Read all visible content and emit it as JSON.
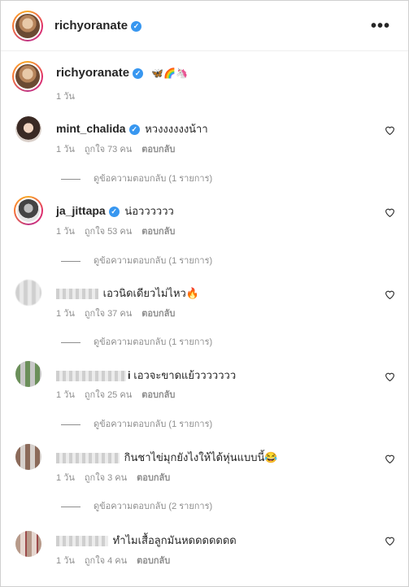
{
  "header": {
    "username": "richyoranate",
    "verified_icon": "check-badge-icon",
    "more_label": "•••"
  },
  "caption": {
    "username": "richyoranate",
    "text": "🦋🌈🦄",
    "time": "1 วัน"
  },
  "comments": [
    {
      "username": "mint_chalida",
      "verified": true,
      "text": "หวงงงงงงน้าา",
      "time": "1 วัน",
      "likes": "ถูกใจ 73 คน",
      "reply": "ตอบกลับ",
      "view_replies": "ดูข้อความตอบกลับ (1 รายการ)"
    },
    {
      "username": "ja_jittapa",
      "verified": true,
      "text": "น่อวววววว",
      "time": "1 วัน",
      "likes": "ถูกใจ 53 คน",
      "reply": "ตอบกลับ",
      "view_replies": "ดูข้อความตอบกลับ (1 รายการ)"
    },
    {
      "username_suffix": "",
      "text": "เอวนิดเดียวไม่ไหว🔥",
      "time": "1 วัน",
      "likes": "ถูกใจ 37 คน",
      "reply": "ตอบกลับ",
      "view_replies": "ดูข้อความตอบกลับ (1 รายการ)"
    },
    {
      "username_suffix": "i",
      "text": "เอวจะขาดแย้ววววววว",
      "time": "1 วัน",
      "likes": "ถูกใจ 25 คน",
      "reply": "ตอบกลับ",
      "view_replies": "ดูข้อความตอบกลับ (1 รายการ)"
    },
    {
      "username_suffix": "",
      "text": "กินชาไข่มุกยังไงให้ได้หุ่นแบบนี้😂",
      "time": "1 วัน",
      "likes": "ถูกใจ 3 คน",
      "reply": "ตอบกลับ",
      "view_replies": "ดูข้อความตอบกลับ (2 รายการ)"
    },
    {
      "username_suffix": "",
      "text": "ทำไมเสื้อลูกมันหดดดดดดด",
      "time": "1 วัน",
      "likes": "ถูกใจ 4 คน",
      "reply": "ตอบกลับ"
    }
  ],
  "icons": {
    "heart": "heart-outline-icon",
    "more": "more-horizontal-icon"
  },
  "colors": {
    "verified": "#3897f0",
    "muted": "#8e8e8e",
    "text": "#262626"
  }
}
